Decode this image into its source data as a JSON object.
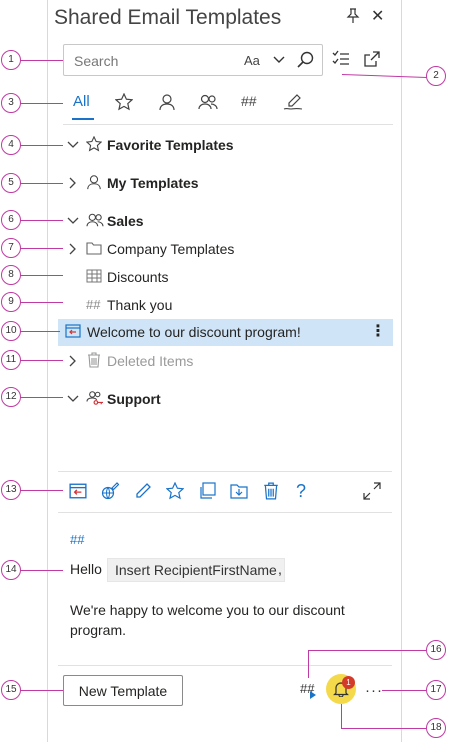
{
  "header": {
    "title": "Shared Email Templates"
  },
  "search": {
    "placeholder": "Search",
    "case_label": "Aa"
  },
  "tabs": [
    {
      "label": "All",
      "active": true
    },
    {
      "icon": "star-icon"
    },
    {
      "icon": "user-icon"
    },
    {
      "icon": "users-icon"
    },
    {
      "label": "##"
    },
    {
      "icon": "signature-icon"
    }
  ],
  "tree": [
    {
      "label": "Favorite Templates",
      "icon": "star-icon",
      "expanded": true
    },
    {
      "label": "My Templates",
      "icon": "user-icon",
      "expanded": false
    },
    {
      "label": "Sales",
      "icon": "users-icon",
      "expanded": true
    },
    {
      "label": "Company Templates",
      "icon": "folder-icon",
      "expanded": false
    },
    {
      "label": "Discounts",
      "icon": "table-icon"
    },
    {
      "label": "Thank you",
      "icon": "hash-icon"
    },
    {
      "label": "Welcome to our discount program!",
      "icon": "insert-template-icon",
      "selected": true
    },
    {
      "label": "Deleted Items",
      "icon": "trash-icon",
      "expanded": false
    },
    {
      "label": "Support",
      "icon": "users-key-icon",
      "expanded": true
    }
  ],
  "preview": {
    "hash": "##",
    "greeting": "Hello",
    "macro": "Insert RecipientFirstName",
    "comma": ",",
    "body": "We're happy to welcome you to our discount program."
  },
  "footer": {
    "new_template": "New Template",
    "hash_label": "##",
    "notification_count": "1",
    "more": "···"
  },
  "callouts": [
    "1",
    "2",
    "3",
    "4",
    "5",
    "6",
    "7",
    "8",
    "9",
    "10",
    "11",
    "12",
    "13",
    "14",
    "15",
    "16",
    "17",
    "18"
  ],
  "colors": {
    "accent": "#1a73c8",
    "callout": "#c03aa3",
    "selected_row": "#cfe4f6",
    "bell": "#f4d94a",
    "badge": "#d23a2a"
  }
}
